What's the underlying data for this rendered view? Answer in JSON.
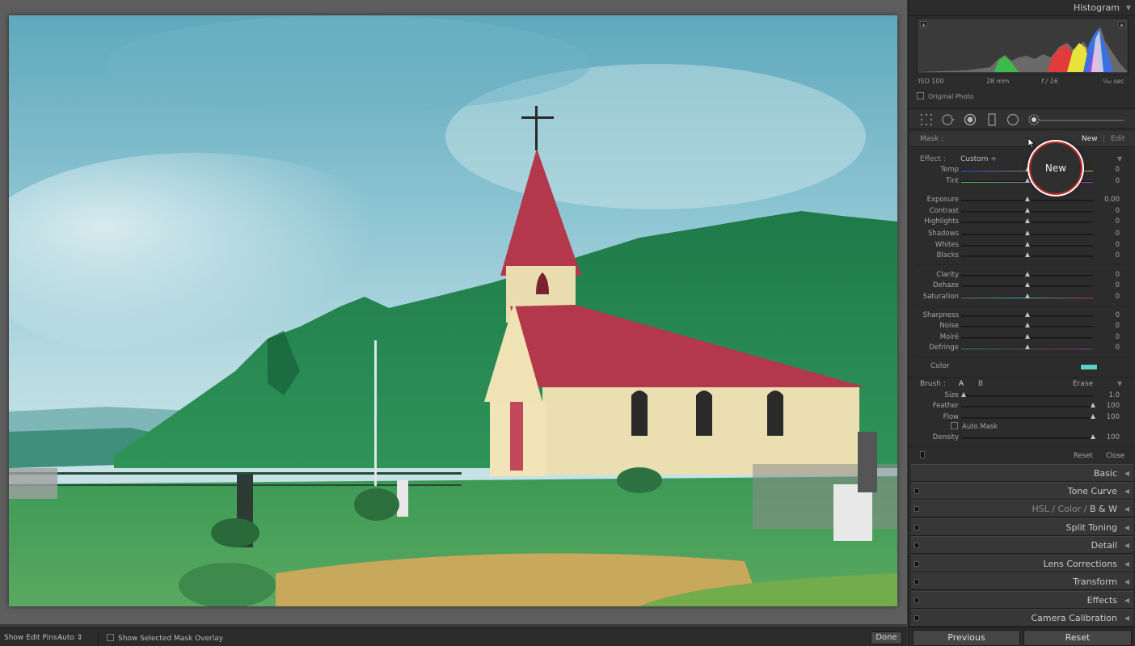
{
  "toolbar": {
    "show_edit_pins_label": "Show Edit Pins :",
    "show_edit_pins_value": "Auto",
    "show_mask_overlay_label": "Show Selected Mask Overlay",
    "done_label": "Done"
  },
  "histogram": {
    "title": "Histogram",
    "iso": "ISO 100",
    "focal": "28 mm",
    "aperture": "f / 16",
    "shutter": "¹⁄₄₀ sec",
    "original_photo_label": "Original Photo"
  },
  "mask": {
    "label": "Mask :",
    "new_label": "New",
    "edit_label": "Edit"
  },
  "effect": {
    "label": "Effect :",
    "value": "Custom ÷"
  },
  "sliders": {
    "temp": {
      "label": "Temp",
      "value": "0",
      "pos": 0.5
    },
    "tint": {
      "label": "Tint",
      "value": "0",
      "pos": 0.5
    },
    "exposure": {
      "label": "Exposure",
      "value": "0.00",
      "pos": 0.5
    },
    "contrast": {
      "label": "Contrast",
      "value": "0",
      "pos": 0.5
    },
    "highlights": {
      "label": "Highlights",
      "value": "0",
      "pos": 0.5
    },
    "shadows": {
      "label": "Shadows",
      "value": "0",
      "pos": 0.5
    },
    "whites": {
      "label": "Whites",
      "value": "0",
      "pos": 0.5
    },
    "blacks": {
      "label": "Blacks",
      "value": "0",
      "pos": 0.5
    },
    "clarity": {
      "label": "Clarity",
      "value": "0",
      "pos": 0.5
    },
    "dehaze": {
      "label": "Dehaze",
      "value": "0",
      "pos": 0.5
    },
    "saturation": {
      "label": "Saturation",
      "value": "0",
      "pos": 0.5
    },
    "sharpness": {
      "label": "Sharpness",
      "value": "0",
      "pos": 0.5
    },
    "noise": {
      "label": "Noise",
      "value": "0",
      "pos": 0.5
    },
    "moire": {
      "label": "Moiré",
      "value": "0",
      "pos": 0.5
    },
    "defringe": {
      "label": "Defringe",
      "value": "0",
      "pos": 0.5
    },
    "size": {
      "label": "Size",
      "value": "1.0",
      "pos": 0.02
    },
    "feather": {
      "label": "Feather",
      "value": "100",
      "pos": 1.0
    },
    "flow": {
      "label": "Flow",
      "value": "100",
      "pos": 1.0
    },
    "density": {
      "label": "Density",
      "value": "100",
      "pos": 1.0
    }
  },
  "color": {
    "label": "Color",
    "swatch": "#5ed0c4"
  },
  "brush": {
    "label": "Brush :",
    "a_label": "A",
    "b_label": "B",
    "erase_label": "Erase",
    "auto_mask_label": "Auto Mask"
  },
  "panel_footer": {
    "reset_label": "Reset",
    "close_label": "Close"
  },
  "sections": {
    "basic": "Basic",
    "tone_curve": "Tone Curve",
    "hsl": "HSL",
    "color": "Color",
    "bw": "B & W",
    "slash": "/",
    "split_toning": "Split Toning",
    "detail": "Detail",
    "lens_corrections": "Lens Corrections",
    "transform": "Transform",
    "effects": "Effects",
    "camera_calibration": "Camera Calibration"
  },
  "buttons": {
    "previous": "Previous",
    "reset": "Reset"
  },
  "callout": {
    "label": "New"
  }
}
